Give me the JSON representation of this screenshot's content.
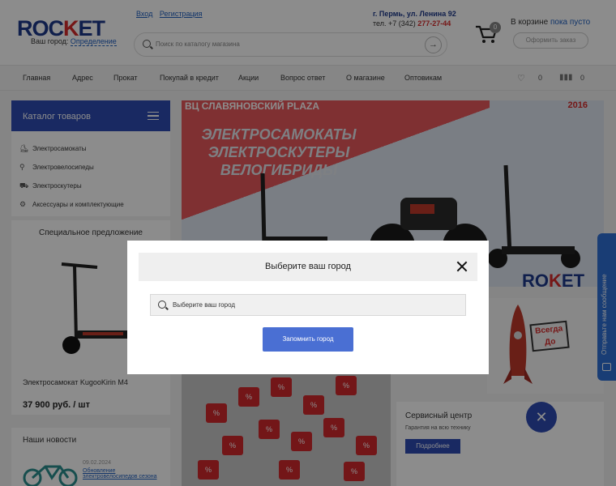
{
  "header": {
    "logo": {
      "part1": "ROC",
      "accent": "K",
      "part2": "ET"
    },
    "city_label": "Ваш город:",
    "city_link": "Определение",
    "login": "Вход",
    "register": "Регистрация",
    "search_placeholder": "Поиск по каталогу магазина",
    "address": "г. Пермь, ул. Ленина 92",
    "phone_prefix": "тел. +7 (342)",
    "phone_number": "277-27-44",
    "cart_count": "0",
    "cart_label": "В корзине",
    "cart_empty": "пока пусто",
    "order_button": "Оформить заказ"
  },
  "nav": {
    "items": [
      "Главная",
      "Адрес",
      "Прокат",
      "Покупай в кредит",
      "Акции",
      "Вопрос ответ",
      "О магазине",
      "Оптовикам"
    ],
    "favorites_count": "0",
    "compare_count": "0"
  },
  "sidebar": {
    "catalog_title": "Каталог товаров",
    "categories": [
      "Электросамокаты",
      "Электровелосипеды",
      "Электроскутеры",
      "Аксессуары и комплектующие"
    ],
    "special_title": "Специальное предложение",
    "special_product": "Электросамокат KugooKirin M4",
    "special_price": "37 900 руб. / шт",
    "news_title": "Наши новости",
    "news_date": "09.02.2024",
    "news_link": "Обновление электровелосипедов сезона"
  },
  "banner": {
    "headline": "ВЦ СЛАВЯНОВСКИЙ PLAZA",
    "year": "2016",
    "lines": [
      "ЭЛЕКТРОСАМОКАТЫ",
      "ЭЛЕКТРОСКУТЕРЫ",
      "ВЕЛОГИБРИДЫ"
    ],
    "brand": {
      "part1": "RO",
      "accent": "K",
      "part2": "ET"
    }
  },
  "tiles": {
    "rocket_sign": "Всегда До",
    "sale_symbol": "%",
    "service_title": "Сервисный центр",
    "service_sub": "Гарантия на всю технику",
    "service_button": "Подробнее"
  },
  "chat": {
    "label": "Отправьте нам сообщение"
  },
  "modal": {
    "title": "Выберите ваш город",
    "input_placeholder": "Выберите ваш город",
    "submit": "Запомнить город"
  },
  "colors": {
    "brand_blue": "#1e3a8a",
    "accent_red": "#d62b2b",
    "button_blue": "#4a6fd3",
    "catalog_blue": "#2f4cb3"
  }
}
